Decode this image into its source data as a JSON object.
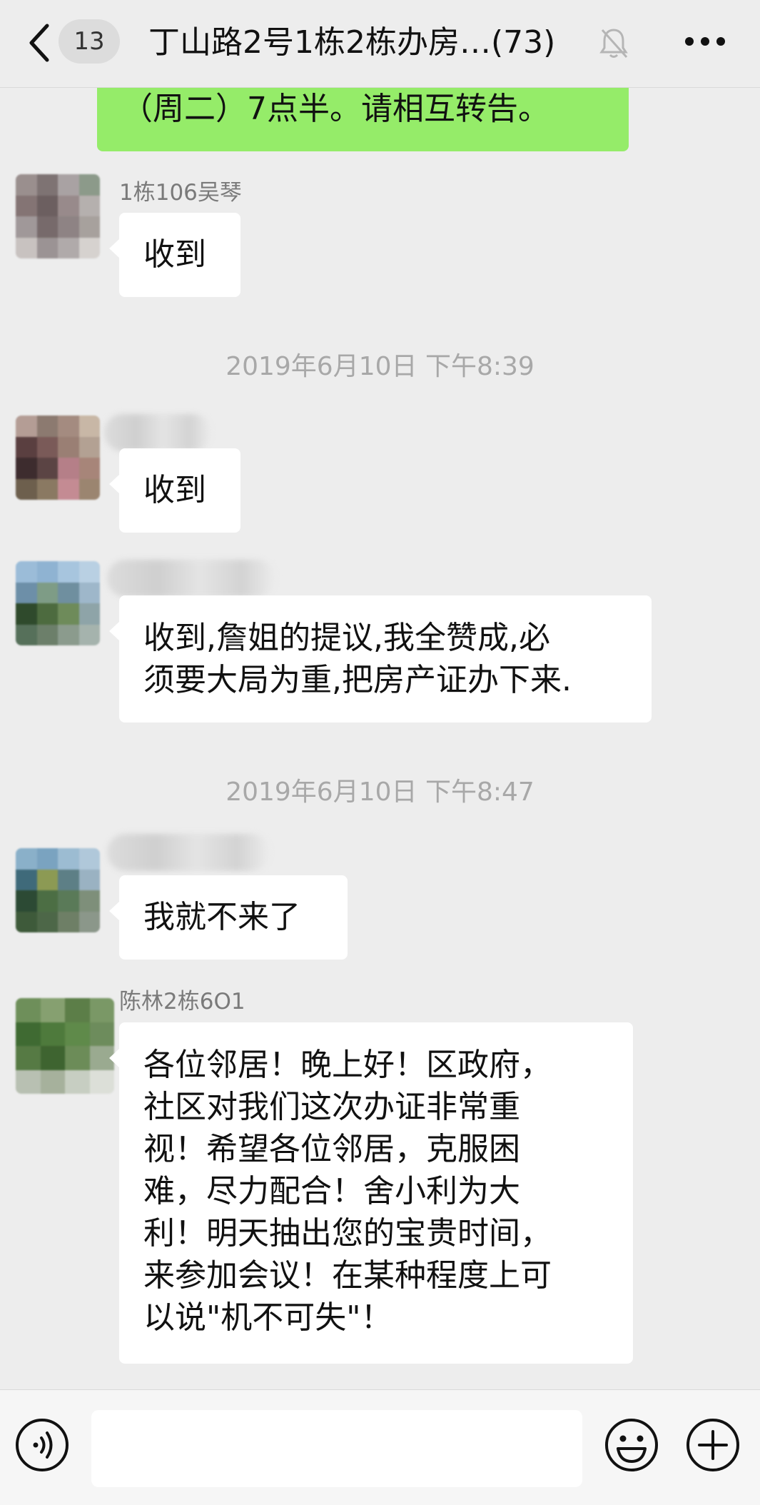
{
  "header": {
    "back_icon": "chevron-left-icon",
    "unread_count": "13",
    "title": "丁山路2号1栋2栋办房…(73)",
    "mute_icon": "bell-slash-icon",
    "more_icon": "more-dots-icon"
  },
  "messages": {
    "m0": {
      "text": "（周二）7点半。请相互转告。"
    },
    "m1": {
      "sender": "1栋106吴琴",
      "text": "收到"
    },
    "t1": "2019年6月10日 下午8:39",
    "m2": {
      "text": "收到"
    },
    "m3": {
      "lines": [
        "收到,詹姐的提议,我全赞成,必",
        "须要大局为重,把房产证办下来."
      ]
    },
    "t2": "2019年6月10日 下午8:47",
    "m4": {
      "text": "我就不来了"
    },
    "m5": {
      "sender": "陈林2栋6O1",
      "lines": [
        "各位邻居！晚上好！区政府，",
        "社区对我们这次办证非常重",
        "视！希望各位邻居，克服困",
        "难，尽力配合！舍小利为大",
        "利！明天抽出您的宝贵时间，",
        "来参加会议！在某种程度上可",
        "以说\"机不可失\"！"
      ]
    }
  },
  "input_bar": {
    "voice_icon": "voice-icon",
    "emoji_icon": "emoji-icon",
    "plus_icon": "plus-icon",
    "text_value": ""
  },
  "colors": {
    "background": "#ededed",
    "own_bubble": "#95ec69",
    "other_bubble": "#ffffff",
    "timestamp": "#a8a8a8"
  }
}
